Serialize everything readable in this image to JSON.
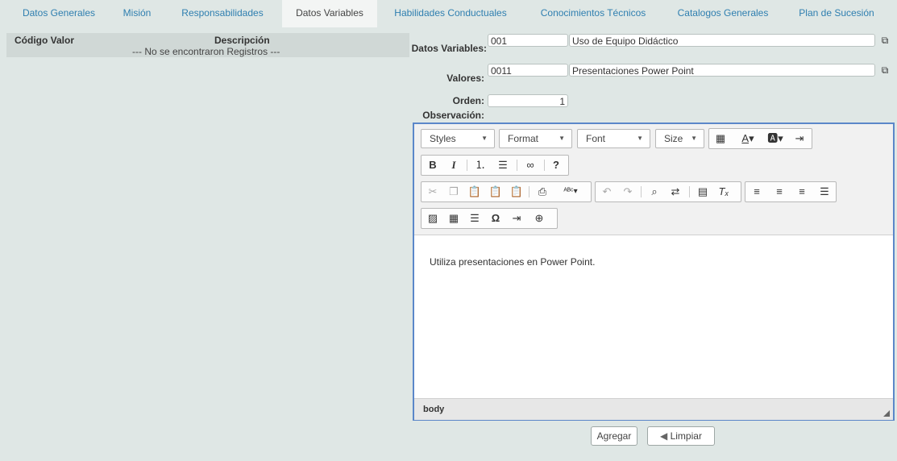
{
  "tabs": [
    {
      "label": "Datos Generales",
      "active": false
    },
    {
      "label": "Misión",
      "active": false
    },
    {
      "label": "Responsabilidades",
      "active": false
    },
    {
      "label": "Datos Variables",
      "active": true
    },
    {
      "label": "Habilidades Conductuales",
      "active": false
    },
    {
      "label": "Conocimientos Técnicos",
      "active": false
    },
    {
      "label": "Catalogos Generales",
      "active": false
    },
    {
      "label": "Plan de Sucesión",
      "active": false
    }
  ],
  "grid": {
    "col_code": "Código Valor",
    "col_desc": "Descripción",
    "empty_text": "--- No se encontraron Registros ---"
  },
  "form": {
    "datos_variables_label": "Datos Variables:",
    "datos_variables_code": "001",
    "datos_variables_desc": "Uso de Equipo Didáctico",
    "valores_label": "Valores:",
    "valores_code": "0011",
    "valores_desc": "Presentaciones Power Point",
    "orden_label": "Orden:",
    "orden_value": "1",
    "observacion_label": "Observación:"
  },
  "editor": {
    "styles": "Styles",
    "format": "Format",
    "font": "Font",
    "size": "Size",
    "content": "Utiliza presentaciones en Power Point.",
    "path": "body"
  },
  "actions": {
    "add": "Agregar",
    "clear": "Limpiar"
  },
  "colors": {
    "accent": "#2f7fb0",
    "editor_border": "#5b87c9",
    "background": "#dfe7e5"
  }
}
